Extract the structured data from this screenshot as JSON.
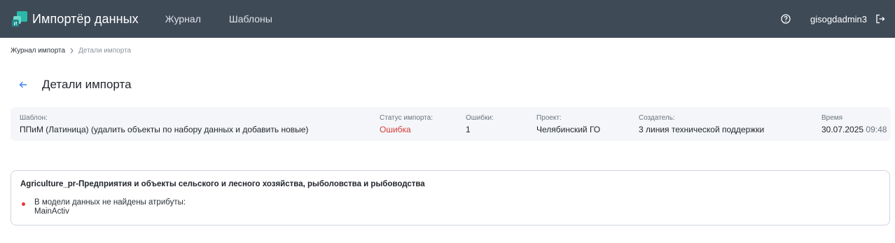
{
  "app": {
    "title": "Импортёр данных"
  },
  "nav": {
    "items": [
      {
        "label": "Журнал"
      },
      {
        "label": "Шаблоны"
      }
    ]
  },
  "user": {
    "name": "gisogdadmin3"
  },
  "icons": {
    "logo": "importer-logo-icon",
    "help": "help-circle-icon",
    "logout": "logout-icon",
    "back": "arrow-left-icon",
    "breadcrumb_separator": "chevron-right-icon"
  },
  "colors": {
    "topbar": "#3f4a57",
    "accent": "#3b82f6",
    "error": "#d93a3a",
    "logo_teal": "#2bb8a8"
  },
  "breadcrumb": {
    "parent": "Журнал импорта",
    "current": "Детали импорта"
  },
  "page": {
    "title": "Детали импорта"
  },
  "details": {
    "template": {
      "label": "Шаблон:",
      "value": "ППиМ (Латиница) (удалить объекты по набору данных и добавить новые)"
    },
    "status": {
      "label": "Статус импорта:",
      "value": "Ошибка"
    },
    "errors": {
      "label": "Ошибки:",
      "value": "1"
    },
    "project": {
      "label": "Проект:",
      "value": "Челябинский ГО"
    },
    "creator": {
      "label": "Создатель:",
      "value": "3 линия технической поддержки"
    },
    "time": {
      "label": "Время",
      "date": "30.07.2025",
      "clock": "09:48"
    }
  },
  "error_block": {
    "heading": "Agriculture_pr-Предприятия и объекты сельского и лесного хозяйства, рыболовства и рыбоводства",
    "items": [
      {
        "message": "В модели данных не найдены атрибуты:",
        "detail": "MainActiv"
      }
    ]
  }
}
